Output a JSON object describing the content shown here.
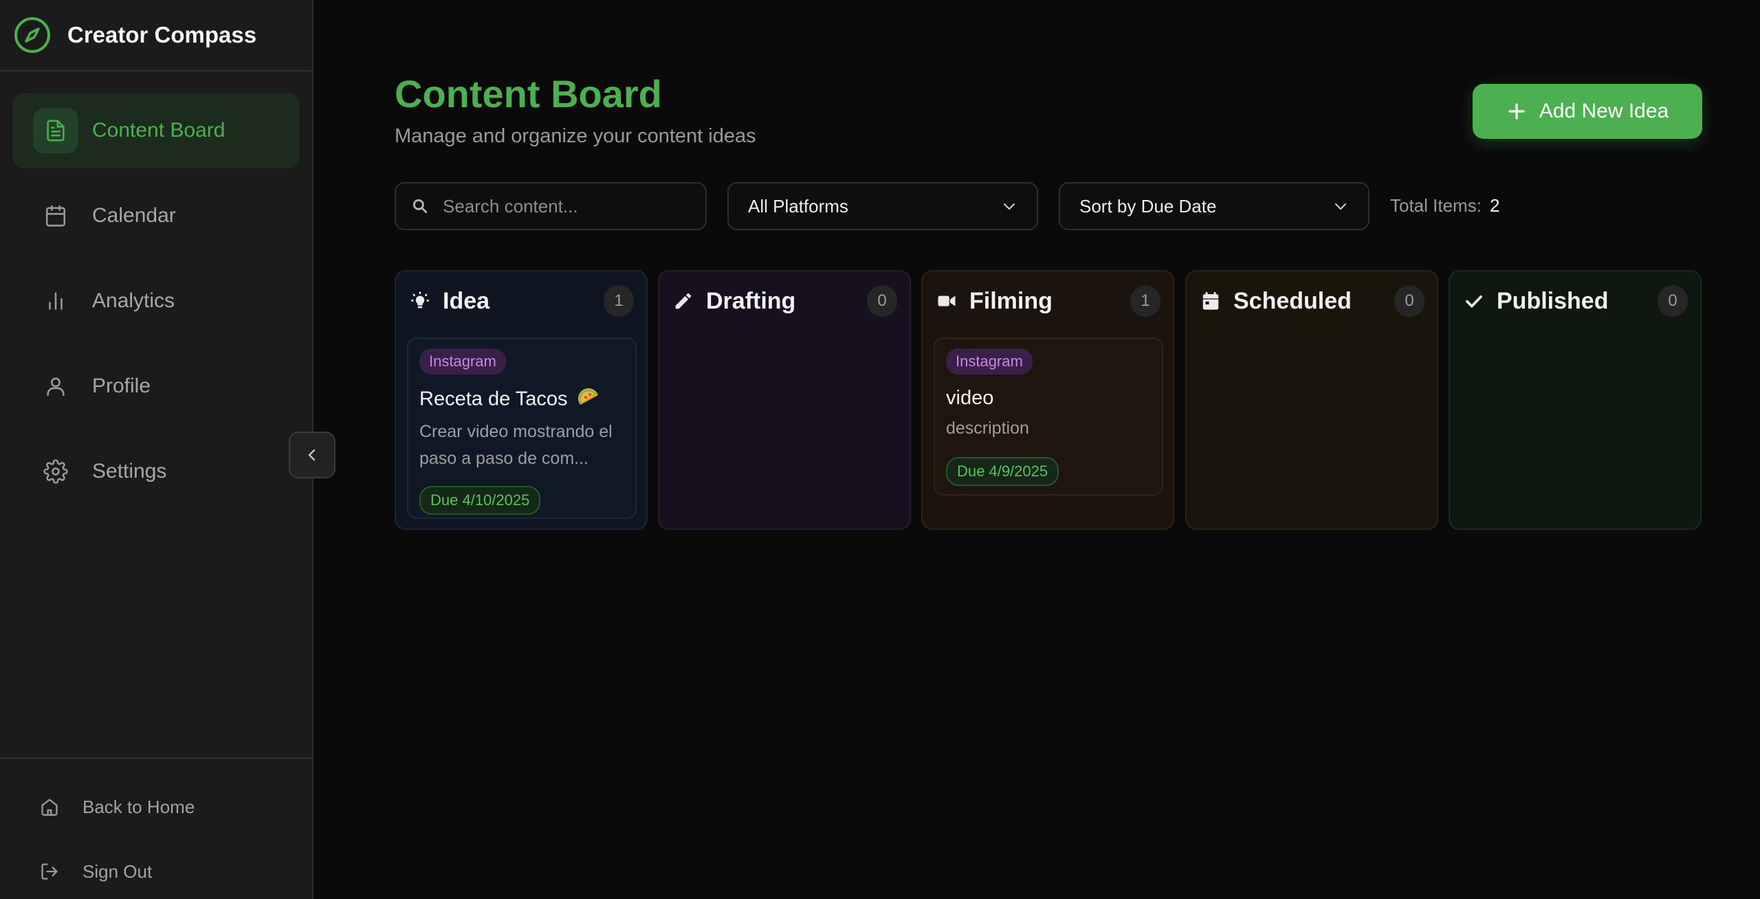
{
  "app": {
    "title": "Creator Compass"
  },
  "sidebar": {
    "items": [
      {
        "label": "Content Board",
        "icon": "document-icon",
        "active": true
      },
      {
        "label": "Calendar",
        "icon": "calendar-icon",
        "active": false
      },
      {
        "label": "Analytics",
        "icon": "bar-chart-icon",
        "active": false
      },
      {
        "label": "Profile",
        "icon": "user-icon",
        "active": false
      },
      {
        "label": "Settings",
        "icon": "gear-icon",
        "active": false
      }
    ],
    "footer": [
      {
        "label": "Back to Home",
        "icon": "home-icon"
      },
      {
        "label": "Sign Out",
        "icon": "sign-out-icon"
      }
    ]
  },
  "header": {
    "title": "Content Board",
    "subtitle": "Manage and organize your content ideas",
    "add_button": "Add New Idea"
  },
  "toolbar": {
    "search_placeholder": "Search content...",
    "search_value": "",
    "platform_filter": "All Platforms",
    "sort": "Sort by Due Date",
    "total_label": "Total Items:",
    "total_value": "2"
  },
  "board": {
    "columns": [
      {
        "title": "Idea",
        "icon": "lightbulb-icon",
        "count": "1",
        "cards": [
          {
            "platform": "Instagram",
            "title": "Receta de Tacos",
            "emoji": "taco-icon",
            "description": "Crear video mostrando el paso a paso de com...",
            "due": "Due 4/10/2025"
          }
        ]
      },
      {
        "title": "Drafting",
        "icon": "pencil-icon",
        "count": "0",
        "cards": []
      },
      {
        "title": "Filming",
        "icon": "video-camera-icon",
        "count": "1",
        "cards": [
          {
            "platform": "Instagram",
            "title": "video",
            "description": "description",
            "due": "Due 4/9/2025"
          }
        ]
      },
      {
        "title": "Scheduled",
        "icon": "calendar-icon",
        "count": "0",
        "cards": []
      },
      {
        "title": "Published",
        "icon": "check-icon",
        "count": "0",
        "cards": []
      }
    ]
  },
  "colors": {
    "accent": "#4caf50",
    "background": "#0a0a0a",
    "sidebar": "#1b1b1b",
    "platform_tag": "#c884e6"
  }
}
